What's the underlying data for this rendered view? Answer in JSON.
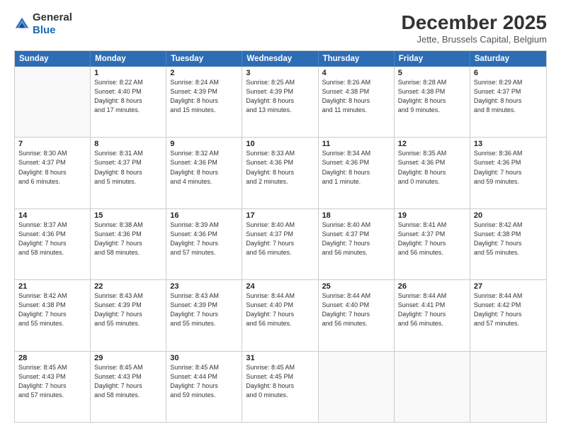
{
  "logo": {
    "general": "General",
    "blue": "Blue"
  },
  "title": "December 2025",
  "subtitle": "Jette, Brussels Capital, Belgium",
  "days": [
    "Sunday",
    "Monday",
    "Tuesday",
    "Wednesday",
    "Thursday",
    "Friday",
    "Saturday"
  ],
  "weeks": [
    [
      {
        "day": "",
        "content": ""
      },
      {
        "day": "1",
        "content": "Sunrise: 8:22 AM\nSunset: 4:40 PM\nDaylight: 8 hours\nand 17 minutes."
      },
      {
        "day": "2",
        "content": "Sunrise: 8:24 AM\nSunset: 4:39 PM\nDaylight: 8 hours\nand 15 minutes."
      },
      {
        "day": "3",
        "content": "Sunrise: 8:25 AM\nSunset: 4:39 PM\nDaylight: 8 hours\nand 13 minutes."
      },
      {
        "day": "4",
        "content": "Sunrise: 8:26 AM\nSunset: 4:38 PM\nDaylight: 8 hours\nand 11 minutes."
      },
      {
        "day": "5",
        "content": "Sunrise: 8:28 AM\nSunset: 4:38 PM\nDaylight: 8 hours\nand 9 minutes."
      },
      {
        "day": "6",
        "content": "Sunrise: 8:29 AM\nSunset: 4:37 PM\nDaylight: 8 hours\nand 8 minutes."
      }
    ],
    [
      {
        "day": "7",
        "content": "Sunrise: 8:30 AM\nSunset: 4:37 PM\nDaylight: 8 hours\nand 6 minutes."
      },
      {
        "day": "8",
        "content": "Sunrise: 8:31 AM\nSunset: 4:37 PM\nDaylight: 8 hours\nand 5 minutes."
      },
      {
        "day": "9",
        "content": "Sunrise: 8:32 AM\nSunset: 4:36 PM\nDaylight: 8 hours\nand 4 minutes."
      },
      {
        "day": "10",
        "content": "Sunrise: 8:33 AM\nSunset: 4:36 PM\nDaylight: 8 hours\nand 2 minutes."
      },
      {
        "day": "11",
        "content": "Sunrise: 8:34 AM\nSunset: 4:36 PM\nDaylight: 8 hours\nand 1 minute."
      },
      {
        "day": "12",
        "content": "Sunrise: 8:35 AM\nSunset: 4:36 PM\nDaylight: 8 hours\nand 0 minutes."
      },
      {
        "day": "13",
        "content": "Sunrise: 8:36 AM\nSunset: 4:36 PM\nDaylight: 7 hours\nand 59 minutes."
      }
    ],
    [
      {
        "day": "14",
        "content": "Sunrise: 8:37 AM\nSunset: 4:36 PM\nDaylight: 7 hours\nand 58 minutes."
      },
      {
        "day": "15",
        "content": "Sunrise: 8:38 AM\nSunset: 4:36 PM\nDaylight: 7 hours\nand 58 minutes."
      },
      {
        "day": "16",
        "content": "Sunrise: 8:39 AM\nSunset: 4:36 PM\nDaylight: 7 hours\nand 57 minutes."
      },
      {
        "day": "17",
        "content": "Sunrise: 8:40 AM\nSunset: 4:37 PM\nDaylight: 7 hours\nand 56 minutes."
      },
      {
        "day": "18",
        "content": "Sunrise: 8:40 AM\nSunset: 4:37 PM\nDaylight: 7 hours\nand 56 minutes."
      },
      {
        "day": "19",
        "content": "Sunrise: 8:41 AM\nSunset: 4:37 PM\nDaylight: 7 hours\nand 56 minutes."
      },
      {
        "day": "20",
        "content": "Sunrise: 8:42 AM\nSunset: 4:38 PM\nDaylight: 7 hours\nand 55 minutes."
      }
    ],
    [
      {
        "day": "21",
        "content": "Sunrise: 8:42 AM\nSunset: 4:38 PM\nDaylight: 7 hours\nand 55 minutes."
      },
      {
        "day": "22",
        "content": "Sunrise: 8:43 AM\nSunset: 4:39 PM\nDaylight: 7 hours\nand 55 minutes."
      },
      {
        "day": "23",
        "content": "Sunrise: 8:43 AM\nSunset: 4:39 PM\nDaylight: 7 hours\nand 55 minutes."
      },
      {
        "day": "24",
        "content": "Sunrise: 8:44 AM\nSunset: 4:40 PM\nDaylight: 7 hours\nand 56 minutes."
      },
      {
        "day": "25",
        "content": "Sunrise: 8:44 AM\nSunset: 4:40 PM\nDaylight: 7 hours\nand 56 minutes."
      },
      {
        "day": "26",
        "content": "Sunrise: 8:44 AM\nSunset: 4:41 PM\nDaylight: 7 hours\nand 56 minutes."
      },
      {
        "day": "27",
        "content": "Sunrise: 8:44 AM\nSunset: 4:42 PM\nDaylight: 7 hours\nand 57 minutes."
      }
    ],
    [
      {
        "day": "28",
        "content": "Sunrise: 8:45 AM\nSunset: 4:43 PM\nDaylight: 7 hours\nand 57 minutes."
      },
      {
        "day": "29",
        "content": "Sunrise: 8:45 AM\nSunset: 4:43 PM\nDaylight: 7 hours\nand 58 minutes."
      },
      {
        "day": "30",
        "content": "Sunrise: 8:45 AM\nSunset: 4:44 PM\nDaylight: 7 hours\nand 59 minutes."
      },
      {
        "day": "31",
        "content": "Sunrise: 8:45 AM\nSunset: 4:45 PM\nDaylight: 8 hours\nand 0 minutes."
      },
      {
        "day": "",
        "content": ""
      },
      {
        "day": "",
        "content": ""
      },
      {
        "day": "",
        "content": ""
      }
    ]
  ]
}
